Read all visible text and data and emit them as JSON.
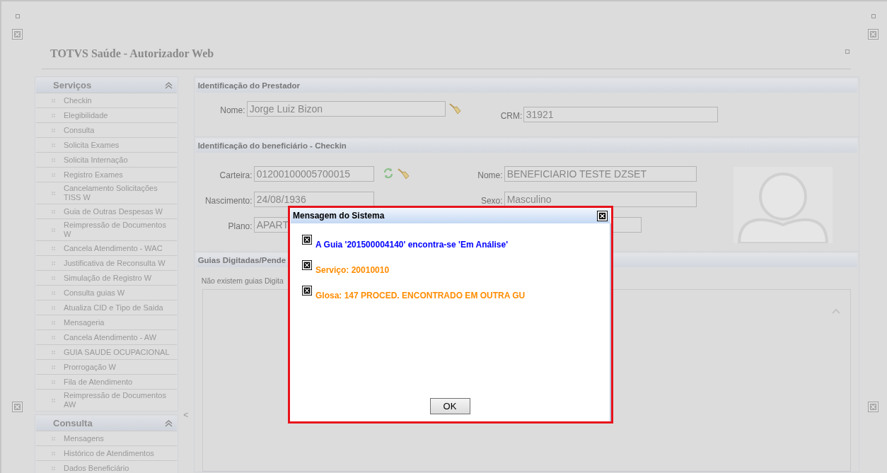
{
  "app_title": "TOTVS Saúde - Autorizador Web",
  "sidebar": [
    {
      "title": "Serviços",
      "expanded": true,
      "items": [
        "Checkin",
        "Elegibilidade",
        "Consulta",
        "Solicita Exames",
        "Solicita Internação",
        "Registro Exames",
        "Cancelamento Solicitações TISS W",
        "Guia de Outras Despesas W",
        "Reimpressão de Documentos W",
        "Cancela Atendimento - WAC",
        "Justificativa de Reconsulta W",
        "Simulação de Registro W",
        "Consulta guias W",
        "Atualiza CID e Tipo de Saida",
        "Mensageria",
        "Cancela Atendimento - AW",
        "GUIA SAUDE OCUPACIONAL",
        "Prorrogação W",
        "Fila de Atendimento",
        "Reimpressão de Documentos AW"
      ]
    },
    {
      "title": "Consulta",
      "expanded": true,
      "items": [
        "Mensagens",
        "Histórico de Atendimentos",
        "Dados Beneficiário"
      ]
    }
  ],
  "collapse_handle": "<",
  "prestador": {
    "title": "Identificação do Prestador",
    "name_label": "Nome:",
    "name_value": "Jorge Luiz Bizon",
    "crm_label": "CRM:",
    "crm_value": "31921"
  },
  "beneficiario": {
    "title": "Identificação do beneficiário - Checkin",
    "fields": [
      {
        "label": "Carteira:",
        "value": "01200100005700015"
      },
      {
        "label": "Nome:",
        "value": "BENEFICIARIO  TESTE DZSET"
      },
      {
        "label": "Nascimento:",
        "value": "24/08/1936"
      },
      {
        "label": "Sexo:",
        "value": "Masculino"
      },
      {
        "label": "Plano:",
        "value": "APART"
      }
    ]
  },
  "guias": {
    "title": "Guias Digitadas/Pende",
    "empty_text": "Não existem guias Digita"
  },
  "dialog": {
    "title": "Mensagem do Sistema",
    "messages": [
      {
        "text": "A Guia '201500004140' encontra-se 'Em Análise'",
        "color": "#0000ff"
      },
      {
        "text": "Serviço: 20010010",
        "color": "#ff8c00"
      },
      {
        "text": "Glosa: 147 PROCED. ENCONTRADO EM OUTRA GU",
        "color": "#ff8c00"
      }
    ],
    "ok": "OK"
  }
}
